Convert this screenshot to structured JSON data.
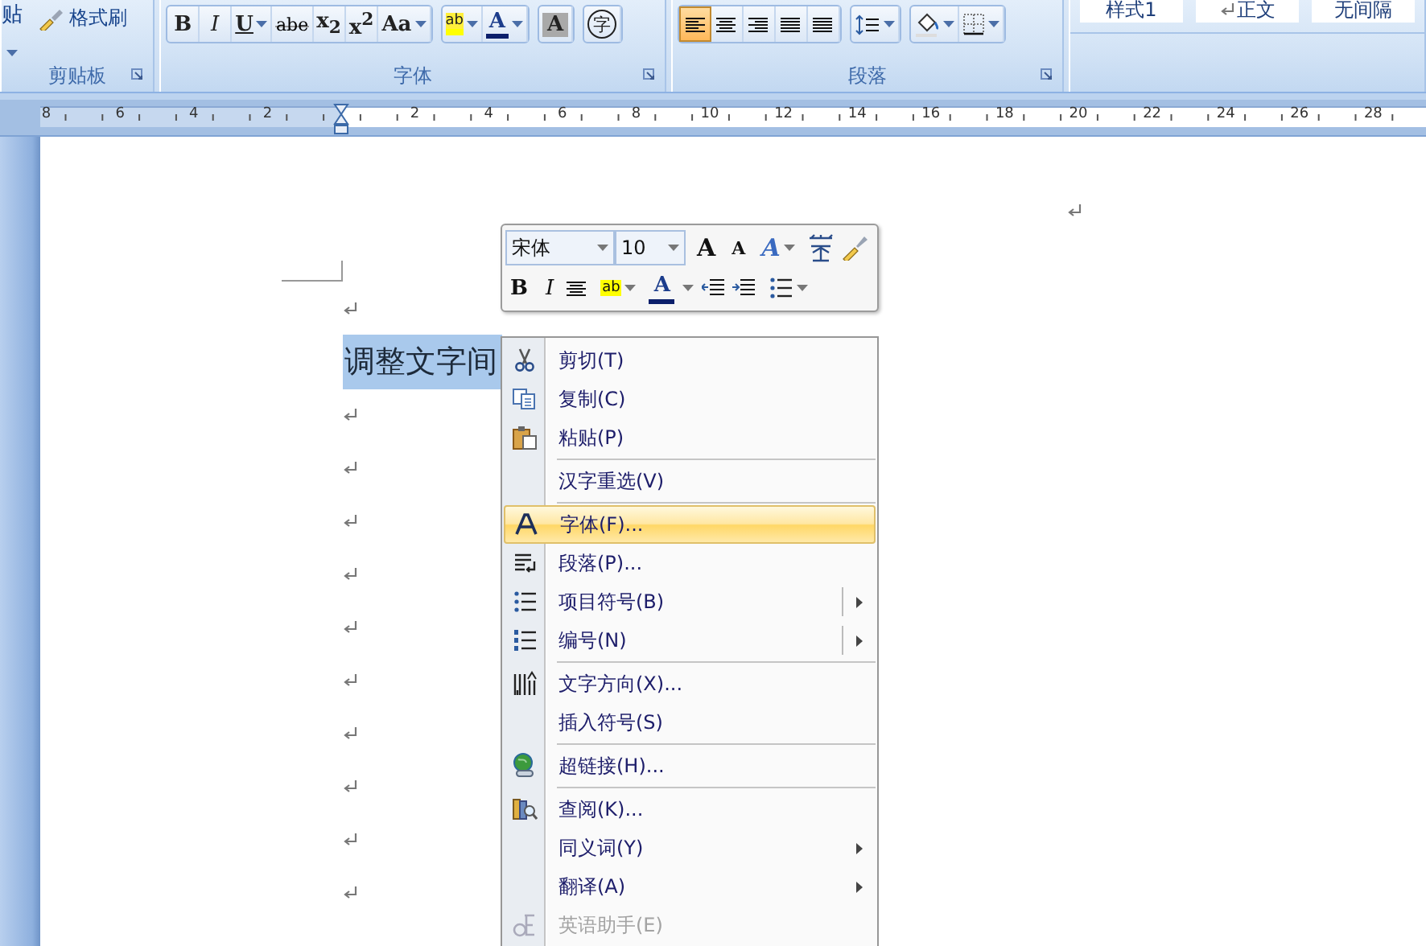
{
  "ribbon": {
    "clipboard": {
      "paste_label": "贴",
      "format_painter": "格式刷",
      "group_label": "剪贴板"
    },
    "font": {
      "clusters": [
        {
          "buttons": [
            {
              "kind": "bold",
              "label": "B",
              "dropdown": false
            },
            {
              "kind": "italic",
              "label": "I",
              "dropdown": false
            },
            {
              "kind": "underline",
              "label": "U",
              "dropdown": true
            },
            {
              "kind": "strike",
              "label": "abe",
              "dropdown": false
            },
            {
              "kind": "sub",
              "label": "x$_{2}$",
              "dropdown": false
            },
            {
              "kind": "sup",
              "label": "x$^{2}$",
              "dropdown": false
            },
            {
              "kind": "case",
              "label": "Aa",
              "dropdown": true
            }
          ]
        },
        {
          "buttons": [
            {
              "kind": "highlight",
              "label": "ab",
              "dropdown": true
            },
            {
              "kind": "color",
              "label": "A",
              "dropdown": true
            }
          ]
        },
        {
          "buttons": [
            {
              "kind": "shade",
              "label": "A",
              "dropdown": false
            }
          ]
        },
        {
          "buttons": [
            {
              "kind": "enclose",
              "label": "字",
              "dropdown": false
            }
          ]
        }
      ],
      "group_label": "字体"
    },
    "paragraph": {
      "align_buttons": [
        {
          "selected": true
        },
        {
          "selected": false
        },
        {
          "selected": false
        },
        {
          "selected": false
        },
        {
          "selected": false
        }
      ],
      "group_label": "段落"
    },
    "styles": [
      {
        "label": "样式1",
        "kind": "plain"
      },
      {
        "label": "正文",
        "kind": "mark"
      },
      {
        "label": "无间隔",
        "kind": "plain"
      }
    ]
  },
  "ruler": {
    "left_numbers": [
      "8",
      "6",
      "4",
      "2"
    ],
    "right_numbers": [
      "2",
      "4",
      "6",
      "8",
      "10",
      "12",
      "14",
      "16",
      "18",
      "20",
      "22",
      "24",
      "26",
      "28"
    ]
  },
  "document": {
    "selected_text": "调整文字间"
  },
  "mini_toolbar": {
    "font_name": "宋体",
    "font_size": "10",
    "grow_label": "A",
    "shrink_label": "A",
    "styles_label": "A",
    "bold_label": "B",
    "italic_label": "I",
    "color_label": "A",
    "highlight_label": "ab"
  },
  "context_menu": {
    "items": [
      {
        "kind": "item",
        "label": "剪切(T)",
        "selected": false,
        "disabled": false,
        "submenu": false,
        "split": false
      },
      {
        "kind": "item",
        "label": "复制(C)",
        "selected": false,
        "disabled": false,
        "submenu": false,
        "split": false
      },
      {
        "kind": "item",
        "label": "粘贴(P)",
        "selected": false,
        "disabled": false,
        "submenu": false,
        "split": false
      },
      {
        "kind": "separator"
      },
      {
        "kind": "item",
        "label": "汉字重选(V)",
        "selected": false,
        "disabled": false,
        "submenu": false,
        "split": false
      },
      {
        "kind": "separator"
      },
      {
        "kind": "item",
        "label": "字体(F)...",
        "selected": true,
        "disabled": false,
        "submenu": false,
        "split": false
      },
      {
        "kind": "item",
        "label": "段落(P)...",
        "selected": false,
        "disabled": false,
        "submenu": false,
        "split": false
      },
      {
        "kind": "item",
        "label": "项目符号(B)",
        "selected": false,
        "disabled": false,
        "submenu": true,
        "split": true
      },
      {
        "kind": "item",
        "label": "编号(N)",
        "selected": false,
        "disabled": false,
        "submenu": true,
        "split": true
      },
      {
        "kind": "separator"
      },
      {
        "kind": "item",
        "label": "文字方向(X)...",
        "selected": false,
        "disabled": false,
        "submenu": false,
        "split": false
      },
      {
        "kind": "item",
        "label": "插入符号(S)",
        "selected": false,
        "disabled": false,
        "submenu": false,
        "split": false
      },
      {
        "kind": "separator"
      },
      {
        "kind": "item",
        "label": "超链接(H)...",
        "selected": false,
        "disabled": false,
        "submenu": false,
        "split": false
      },
      {
        "kind": "separator"
      },
      {
        "kind": "item",
        "label": "查阅(K)...",
        "selected": false,
        "disabled": false,
        "submenu": false,
        "split": false
      },
      {
        "kind": "item",
        "label": "同义词(Y)",
        "selected": false,
        "disabled": false,
        "submenu": true,
        "split": false
      },
      {
        "kind": "item",
        "label": "翻译(A)",
        "selected": false,
        "disabled": false,
        "submenu": true,
        "split": false
      },
      {
        "kind": "item",
        "label": "英语助手(E)",
        "selected": false,
        "disabled": true,
        "submenu": false,
        "split": false
      }
    ]
  }
}
